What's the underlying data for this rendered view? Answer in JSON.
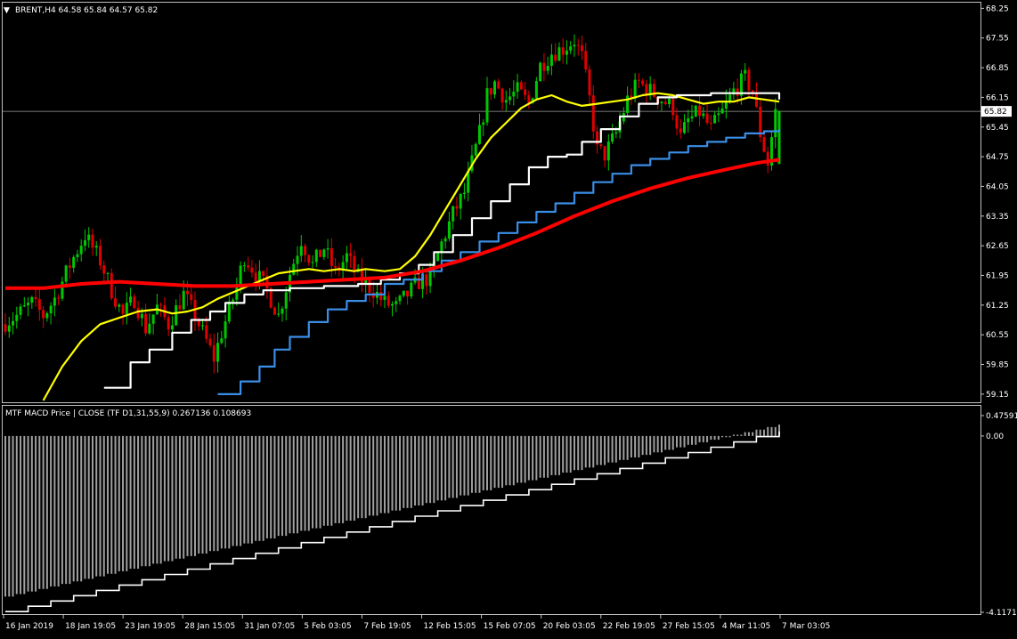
{
  "colors": {
    "background": "#000000",
    "frame": "#c0c0c0",
    "text": "#ffffff",
    "bull_candle": "#00c800",
    "bear_candle": "#e00000",
    "ma_yellow": "#ffff00",
    "ma_white": "#ffffff",
    "ma_blue": "#3a8ee6",
    "ma_red": "#ff0000",
    "bid_line": "#a0a0a0",
    "price_label_bg": "#ffffff",
    "price_label_text": "#000000",
    "macd_histogram": "#a0a0a0",
    "macd_signal": "#ffffff"
  },
  "header": {
    "symbol_line": "BRENT,H4  64.58 65.84 64.57 65.82"
  },
  "chart_data": [
    {
      "type": "candlestick",
      "title": "BRENT,H4  64.58 65.84 64.57 65.82",
      "xlabel": "",
      "ylabel": "",
      "ylim": [
        59.0,
        68.3
      ],
      "y_ticks": [
        "68.25",
        "67.55",
        "66.85",
        "66.15",
        "65.45",
        "64.75",
        "64.05",
        "63.35",
        "62.65",
        "61.95",
        "61.25",
        "60.55",
        "59.85",
        "59.15"
      ],
      "current_price": "65.82",
      "last_bar": {
        "open": 64.58,
        "high": 65.84,
        "low": 64.57,
        "close": 65.82
      },
      "x_ticks": [
        "16 Jan 2019",
        "18 Jan 19:05",
        "23 Jan 19:05",
        "28 Jan 15:05",
        "31 Jan 07:05",
        "5 Feb 03:05",
        "7 Feb 19:05",
        "12 Feb 15:05",
        "15 Feb 07:05",
        "20 Feb 03:05",
        "22 Feb 19:05",
        "27 Feb 15:05",
        "4 Mar 11:05",
        "7 Mar 03:05"
      ],
      "price_path": [
        [
          0,
          60.8
        ],
        [
          4,
          61.0
        ],
        [
          8,
          61.3
        ],
        [
          11,
          61.0
        ],
        [
          14,
          61.4
        ],
        [
          18,
          62.2
        ],
        [
          22,
          62.9
        ],
        [
          26,
          62.3
        ],
        [
          29,
          61.6
        ],
        [
          32,
          61.0
        ],
        [
          35,
          61.4
        ],
        [
          38,
          60.7
        ],
        [
          41,
          61.2
        ],
        [
          44,
          60.8
        ],
        [
          48,
          61.5
        ],
        [
          51,
          61.0
        ],
        [
          54,
          60.4
        ],
        [
          56,
          60.0
        ],
        [
          58,
          60.6
        ],
        [
          61,
          61.4
        ],
        [
          64,
          62.4
        ],
        [
          67,
          62.0
        ],
        [
          70,
          61.6
        ],
        [
          73,
          61.0
        ],
        [
          76,
          62.0
        ],
        [
          79,
          62.8
        ],
        [
          82,
          62.2
        ],
        [
          85,
          62.6
        ],
        [
          88,
          62.0
        ],
        [
          91,
          62.4
        ],
        [
          94,
          61.9
        ],
        [
          98,
          61.6
        ],
        [
          101,
          61.3
        ],
        [
          104,
          61.2
        ],
        [
          107,
          61.5
        ],
        [
          110,
          61.8
        ],
        [
          113,
          61.9
        ],
        [
          116,
          62.7
        ],
        [
          119,
          63.4
        ],
        [
          122,
          63.9
        ],
        [
          124,
          64.6
        ],
        [
          126,
          65.3
        ],
        [
          128,
          66.2
        ],
        [
          130,
          66.5
        ],
        [
          133,
          66.1
        ],
        [
          136,
          66.3
        ],
        [
          139,
          66.0
        ],
        [
          142,
          66.9
        ],
        [
          145,
          67.2
        ],
        [
          148,
          67.3
        ],
        [
          151,
          67.5
        ],
        [
          153,
          67.1
        ],
        [
          155,
          66.1
        ],
        [
          157,
          64.9
        ],
        [
          159,
          64.8
        ],
        [
          162,
          65.3
        ],
        [
          165,
          66.1
        ],
        [
          168,
          66.5
        ],
        [
          171,
          66.3
        ],
        [
          174,
          66.1
        ],
        [
          177,
          65.9
        ],
        [
          179,
          65.2
        ],
        [
          181,
          65.6
        ],
        [
          184,
          65.8
        ],
        [
          187,
          65.4
        ],
        [
          190,
          65.8
        ],
        [
          193,
          66.3
        ],
        [
          196,
          66.6
        ],
        [
          198,
          66.3
        ],
        [
          200,
          65.3
        ],
        [
          202,
          64.6
        ],
        [
          204,
          65.82
        ]
      ],
      "series": [
        {
          "name": "",
          "color": "#ffff00",
          "values": [
            [
              10,
              59.0
            ],
            [
              15,
              59.8
            ],
            [
              20,
              60.4
            ],
            [
              25,
              60.8
            ],
            [
              30,
              60.95
            ],
            [
              35,
              61.1
            ],
            [
              40,
              61.15
            ],
            [
              44,
              61.05
            ],
            [
              48,
              61.1
            ],
            [
              52,
              61.2
            ],
            [
              56,
              61.4
            ],
            [
              60,
              61.55
            ],
            [
              64,
              61.7
            ],
            [
              68,
              61.85
            ],
            [
              72,
              62.0
            ],
            [
              76,
              62.05
            ],
            [
              80,
              62.1
            ],
            [
              84,
              62.05
            ],
            [
              88,
              62.1
            ],
            [
              92,
              62.05
            ],
            [
              95,
              62.1
            ],
            [
              100,
              62.05
            ],
            [
              104,
              62.1
            ],
            [
              108,
              62.4
            ],
            [
              112,
              62.9
            ],
            [
              116,
              63.5
            ],
            [
              120,
              64.1
            ],
            [
              124,
              64.7
            ],
            [
              128,
              65.2
            ],
            [
              132,
              65.55
            ],
            [
              136,
              65.9
            ],
            [
              140,
              66.1
            ],
            [
              144,
              66.2
            ],
            [
              148,
              66.05
            ],
            [
              152,
              65.95
            ],
            [
              156,
              66.0
            ],
            [
              160,
              66.05
            ],
            [
              164,
              66.1
            ],
            [
              168,
              66.2
            ],
            [
              172,
              66.25
            ],
            [
              176,
              66.2
            ],
            [
              180,
              66.1
            ],
            [
              184,
              66.0
            ],
            [
              188,
              66.05
            ],
            [
              192,
              66.05
            ],
            [
              196,
              66.15
            ],
            [
              200,
              66.1
            ],
            [
              204,
              66.05
            ]
          ]
        },
        {
          "name": "",
          "color": "#ffffff",
          "values": [
            [
              26,
              59.3
            ],
            [
              33,
              59.9
            ],
            [
              38,
              60.2
            ],
            [
              44,
              60.6
            ],
            [
              49,
              60.9
            ],
            [
              54,
              61.1
            ],
            [
              58,
              61.3
            ],
            [
              63,
              61.5
            ],
            [
              68,
              61.6
            ],
            [
              75,
              61.65
            ],
            [
              84,
              61.7
            ],
            [
              93,
              61.75
            ],
            [
              99,
              61.85
            ],
            [
              104,
              62.0
            ],
            [
              109,
              62.2
            ],
            [
              113,
              62.5
            ],
            [
              118,
              62.9
            ],
            [
              123,
              63.3
            ],
            [
              128,
              63.7
            ],
            [
              133,
              64.1
            ],
            [
              138,
              64.5
            ],
            [
              143,
              64.75
            ],
            [
              148,
              64.8
            ],
            [
              152,
              65.1
            ],
            [
              157,
              65.4
            ],
            [
              162,
              65.7
            ],
            [
              167,
              66.0
            ],
            [
              172,
              66.15
            ],
            [
              177,
              66.2
            ],
            [
              186,
              66.25
            ],
            [
              195,
              66.25
            ],
            [
              204,
              66.1
            ]
          ]
        },
        {
          "name": "",
          "color": "#3a8ee6",
          "values": [
            [
              56,
              59.15
            ],
            [
              62,
              59.45
            ],
            [
              67,
              59.8
            ],
            [
              71,
              60.2
            ],
            [
              75,
              60.5
            ],
            [
              80,
              60.85
            ],
            [
              85,
              61.15
            ],
            [
              90,
              61.35
            ],
            [
              95,
              61.5
            ],
            [
              100,
              61.75
            ],
            [
              105,
              61.85
            ],
            [
              110,
              62.05
            ],
            [
              115,
              62.3
            ],
            [
              120,
              62.5
            ],
            [
              125,
              62.75
            ],
            [
              130,
              62.95
            ],
            [
              135,
              63.2
            ],
            [
              140,
              63.45
            ],
            [
              145,
              63.65
            ],
            [
              150,
              63.9
            ],
            [
              155,
              64.15
            ],
            [
              160,
              64.35
            ],
            [
              165,
              64.55
            ],
            [
              170,
              64.7
            ],
            [
              175,
              64.85
            ],
            [
              180,
              65.0
            ],
            [
              185,
              65.1
            ],
            [
              190,
              65.2
            ],
            [
              195,
              65.3
            ],
            [
              200,
              65.35
            ],
            [
              204,
              65.4
            ]
          ]
        },
        {
          "name": "",
          "color": "#ff0000",
          "values": [
            [
              0,
              61.65
            ],
            [
              10,
              61.65
            ],
            [
              20,
              61.75
            ],
            [
              30,
              61.8
            ],
            [
              40,
              61.75
            ],
            [
              50,
              61.7
            ],
            [
              60,
              61.7
            ],
            [
              70,
              61.75
            ],
            [
              80,
              61.8
            ],
            [
              90,
              61.85
            ],
            [
              100,
              61.9
            ],
            [
              110,
              62.05
            ],
            [
              120,
              62.3
            ],
            [
              130,
              62.6
            ],
            [
              140,
              62.95
            ],
            [
              150,
              63.35
            ],
            [
              160,
              63.7
            ],
            [
              170,
              64.0
            ],
            [
              180,
              64.25
            ],
            [
              190,
              64.45
            ],
            [
              198,
              64.6
            ],
            [
              204,
              64.68
            ]
          ]
        }
      ]
    },
    {
      "type": "bar",
      "title": "MTF MACD Price | CLOSE  (TF D1,31,55,9) 0.267136 0.108693",
      "xlabel": "",
      "ylabel": "",
      "ylim": [
        -4.1171,
        0.47591
      ],
      "y_ticks": [
        "0.47591",
        "0.00",
        "-4.11710"
      ],
      "histogram": {
        "x_range": [
          0,
          204
        ],
        "start": -3.75,
        "end": 0.267136,
        "step_every": 3
      },
      "signal": {
        "start": -4.1,
        "end": 0.108693,
        "step_every": 6
      }
    }
  ]
}
